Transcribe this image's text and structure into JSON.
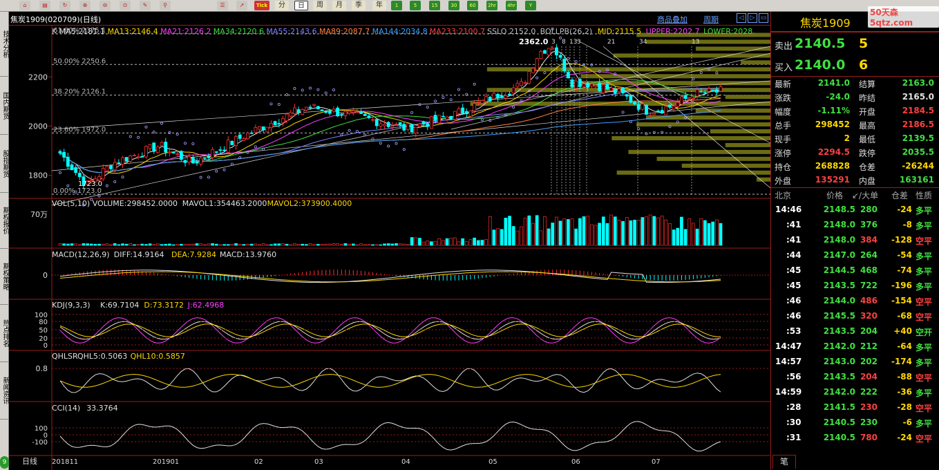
{
  "toolbar": {
    "tools": [
      "home-icon",
      "db-icon",
      "refresh-icon",
      "zoom-in-icon",
      "zoom-out-icon",
      "zoom-icon",
      "pen-icon",
      "pin-icon"
    ],
    "periods": [
      "分",
      "日",
      "周",
      "月",
      "季",
      "年",
      "1",
      "5",
      "15",
      "30",
      "60",
      "2hr",
      "4hr",
      "Y"
    ],
    "tick_label": "Tick"
  },
  "left_tabs": [
    "技术分析",
    "国内期货",
    "股指期货",
    "期权报价",
    "期权策略",
    "热点排名",
    "新闻资讯"
  ],
  "chart_header": {
    "title": "焦炭1909(020709)(日线)",
    "link1": "商品叠加",
    "link2": "周期"
  },
  "main_legend": [
    {
      "text": "K",
      "color": "#c0c0c0"
    },
    {
      "text": "MA5:2181.1",
      "color": "#e0e0e0"
    },
    {
      "text": "MA13:2146.4",
      "color": "#ffd800"
    },
    {
      "text": "MA21:2126.2",
      "color": "#ff40ff"
    },
    {
      "text": "MA34:2120.6",
      "color": "#40e040"
    },
    {
      "text": "MA55:2143.6",
      "color": "#8080ff"
    },
    {
      "text": "MA89:2087.7",
      "color": "#ff8040"
    },
    {
      "text": "MA144:2034.8",
      "color": "#40a0ff"
    },
    {
      "text": "MA233:2100.7",
      "color": "#ff4040"
    },
    {
      "text": "SSLO 2152.0",
      "color": "#c0c0c0"
    },
    {
      "text": "BOLLPB(26,2)",
      "color": "#c0c0c0"
    },
    {
      "text": "MID:2115.5",
      "color": "#ffd800"
    },
    {
      "text": "UPPER:2202.7",
      "color": "#ff40ff"
    },
    {
      "text": "LOWER:2028.",
      "color": "#40e040"
    }
  ],
  "fib_labels": [
    "61.80% 2375.1",
    "50.00% 2250.6",
    "38.20% 2126.1",
    "23.60% 1972.0",
    "0.00% 1723.0"
  ],
  "price_axis": [
    "2200",
    "2000",
    "1800"
  ],
  "peak_label": "2362.0",
  "trough_label": "1723.0",
  "count_labels": [
    "3",
    "13",
    "21",
    "34",
    "13",
    "8",
    "3"
  ],
  "volume": {
    "legend": [
      {
        "text": "VOL(5,10) VOLUME:298452.0000",
        "color": "#e0e0e0"
      },
      {
        "text": "MAVOL1:354463.2000",
        "color": "#e0e0e0"
      },
      {
        "text": "MAVOL2:373900.4000",
        "color": "#ffd800"
      }
    ],
    "axis": "70万"
  },
  "macd": {
    "legend": [
      {
        "text": "MACD(12,26,9)",
        "color": "#e0e0e0"
      },
      {
        "text": "DIFF:14.9164",
        "color": "#e0e0e0"
      },
      {
        "text": "DEA:7.9284",
        "color": "#ffd800"
      },
      {
        "text": "MACD:13.9760",
        "color": "#e0e0e0"
      }
    ],
    "axis": "0"
  },
  "kdj": {
    "legend": [
      {
        "text": "KDJ(9,3,3)",
        "color": "#e0e0e0"
      },
      {
        "text": "K:69.7104",
        "color": "#e0e0e0"
      },
      {
        "text": "D:73.3172",
        "color": "#ffd800"
      },
      {
        "text": "J:62.4968",
        "color": "#ff40ff"
      }
    ],
    "axis": [
      "100",
      "80",
      "50",
      "20",
      "0"
    ]
  },
  "qhlsr": {
    "legend": [
      {
        "text": "QHLSR",
        "color": "#e0e0e0"
      },
      {
        "text": "QHL5:0.5063",
        "color": "#e0e0e0"
      },
      {
        "text": "QHL10:0.5857",
        "color": "#ffd800"
      }
    ],
    "axis": "0.8"
  },
  "cci": {
    "legend": [
      {
        "text": "CCI(14)",
        "color": "#e0e0e0"
      },
      {
        "text": "33.3764",
        "color": "#e0e0e0"
      }
    ],
    "axis": [
      "100",
      "0",
      "-100"
    ]
  },
  "date_axis": {
    "label": "日线",
    "ticks": [
      "201811",
      "201901",
      "02",
      "03",
      "04",
      "05",
      "06",
      "07"
    ]
  },
  "quote": {
    "name": "焦炭1909",
    "logo": "50天森 5qtz.com",
    "ask_label": "卖出",
    "ask_price": "2140.5",
    "ask_vol": "5",
    "bid_label": "买入",
    "bid_price": "2140.0",
    "bid_vol": "6",
    "fields": [
      [
        "最新",
        "2141.0",
        "#40e040",
        "结算",
        "2163.0",
        "#40e040"
      ],
      [
        "涨跌",
        "-24.0",
        "#40e040",
        "昨结",
        "2165.0",
        "#e0e0e0"
      ],
      [
        "幅度",
        "-1.11%",
        "#40e040",
        "开盘",
        "2184.5",
        "#ff4040"
      ],
      [
        "总手",
        "298452",
        "#ffd800",
        "最高",
        "2186.5",
        "#ff4040"
      ],
      [
        "现手",
        "2",
        "#ffd800",
        "最低",
        "2139.5",
        "#40e040"
      ],
      [
        "涨停",
        "2294.5",
        "#ff4040",
        "跌停",
        "2035.5",
        "#40e040"
      ],
      [
        "持仓",
        "268828",
        "#ffd800",
        "仓差",
        "-26244",
        "#ffd800"
      ],
      [
        "外盘",
        "135291",
        "#ff4040",
        "内盘",
        "163161",
        "#40e040"
      ]
    ]
  },
  "ticks_header": [
    "北京",
    "价格",
    "↙/大单",
    "仓差",
    "性质"
  ],
  "ticks": [
    [
      "14:46",
      "2148.5",
      "280",
      "-24",
      "多平",
      "#40e040"
    ],
    [
      ":41",
      "2148.0",
      "376",
      "-8",
      "多平",
      "#40e040"
    ],
    [
      ":41",
      "2148.0",
      "384",
      "-128",
      "空平",
      "#ff4040"
    ],
    [
      ":44",
      "2147.0",
      "264",
      "-54",
      "多平",
      "#40e040"
    ],
    [
      ":45",
      "2144.5",
      "468",
      "-74",
      "多平",
      "#40e040"
    ],
    [
      ":45",
      "2143.5",
      "722",
      "-196",
      "多平",
      "#40e040"
    ],
    [
      ":46",
      "2144.0",
      "486",
      "-154",
      "空平",
      "#ff4040"
    ],
    [
      ":46",
      "2145.5",
      "320",
      "-68",
      "空平",
      "#ff4040"
    ],
    [
      ":53",
      "2143.5",
      "204",
      "+40",
      "空开",
      "#40e040"
    ],
    [
      "14:47",
      "2142.0",
      "212",
      "-64",
      "多平",
      "#40e040"
    ],
    [
      "14:57",
      "2143.0",
      "202",
      "-174",
      "多平",
      "#40e040"
    ],
    [
      ":56",
      "2143.5",
      "204",
      "-88",
      "空平",
      "#ff4040"
    ],
    [
      "14:59",
      "2142.0",
      "222",
      "-36",
      "多平",
      "#40e040"
    ],
    [
      ":28",
      "2141.5",
      "230",
      "-28",
      "空平",
      "#ff4040"
    ],
    [
      ":30",
      "2140.5",
      "230",
      "-6",
      "多平",
      "#40e040"
    ],
    [
      ":31",
      "2140.5",
      "780",
      "-24",
      "空平",
      "#ff4040"
    ]
  ],
  "bottom_tab": "笔",
  "chart_data": {
    "type": "candlestick",
    "x_range": [
      "201811",
      "201907"
    ],
    "ylim": [
      1723,
      2375
    ],
    "last_close": 2141.0,
    "high": 2362.0,
    "low": 1723.0
  }
}
